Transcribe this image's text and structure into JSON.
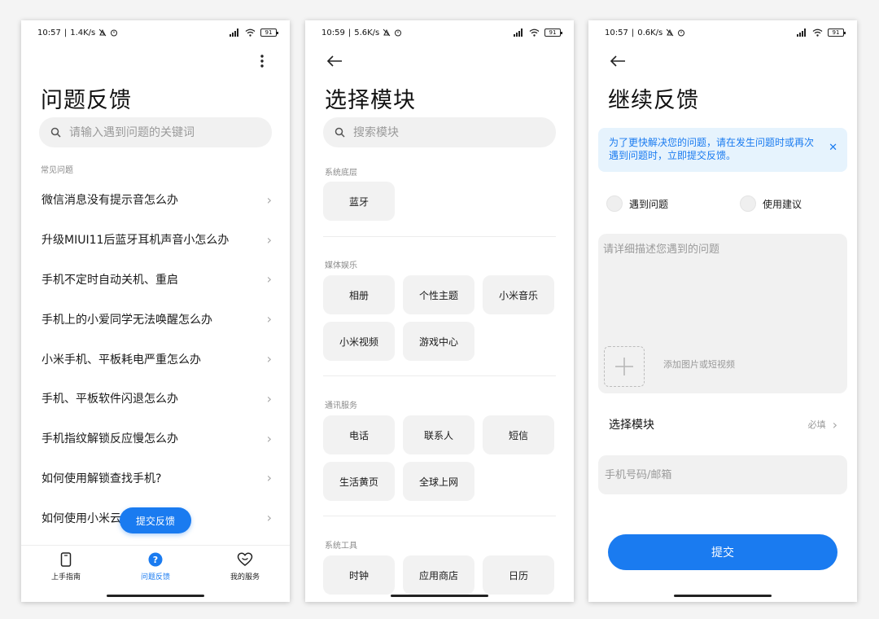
{
  "colors": {
    "accent": "#1a7bf0",
    "notice_bg": "#e6f3fd",
    "chip_bg": "#f2f2f2"
  },
  "screen1": {
    "status": {
      "time": "10:57",
      "speed": "1.4K/s",
      "battery": "91"
    },
    "more_icon": "more-vertical-icon",
    "title": "问题反馈",
    "search_placeholder": "请输入遇到问题的关键词",
    "section_label": "常见问题",
    "faq": [
      "微信消息没有提示音怎么办",
      "升级MIUI11后蓝牙耳机声音小怎么办",
      "手机不定时自动关机、重启",
      "手机上的小爱同学无法唤醒怎么办",
      "小米手机、平板耗电严重怎么办",
      "手机、平板软件闪退怎么办",
      "手机指纹解锁反应慢怎么办",
      "如何使用解锁查找手机?",
      "如何使用小米云"
    ],
    "fab_label": "提交反馈",
    "nav": [
      {
        "label": "上手指南",
        "icon": "phone-icon"
      },
      {
        "label": "问题反馈",
        "icon": "question-icon"
      },
      {
        "label": "我的服务",
        "icon": "heart-icon"
      }
    ]
  },
  "screen2": {
    "status": {
      "time": "10:59",
      "speed": "5.6K/s",
      "battery": "91"
    },
    "title": "选择模块",
    "search_placeholder": "搜索模块",
    "sections": [
      {
        "label": "系统底层",
        "items": [
          "蓝牙"
        ]
      },
      {
        "label": "媒体娱乐",
        "items": [
          "相册",
          "个性主题",
          "小米音乐",
          "小米视频",
          "游戏中心"
        ]
      },
      {
        "label": "通讯服务",
        "items": [
          "电话",
          "联系人",
          "短信",
          "生活黄页",
          "全球上网"
        ]
      },
      {
        "label": "系统工具",
        "items": [
          "时钟",
          "应用商店",
          "日历"
        ]
      }
    ]
  },
  "screen3": {
    "status": {
      "time": "10:57",
      "speed": "0.6K/s",
      "battery": "91"
    },
    "title": "继续反馈",
    "notice": "为了更快解决您的问题，请在发生问题时或再次遇到问题时，立即提交反馈。",
    "radio_problem": "遇到问题",
    "radio_suggest": "使用建议",
    "desc_placeholder": "请详细描述您遇到的问题",
    "add_media_label": "添加图片或短视频",
    "select_module_label": "选择模块",
    "select_module_hint": "必填",
    "contact_placeholder": "手机号码/邮箱",
    "submit_label": "提交"
  }
}
